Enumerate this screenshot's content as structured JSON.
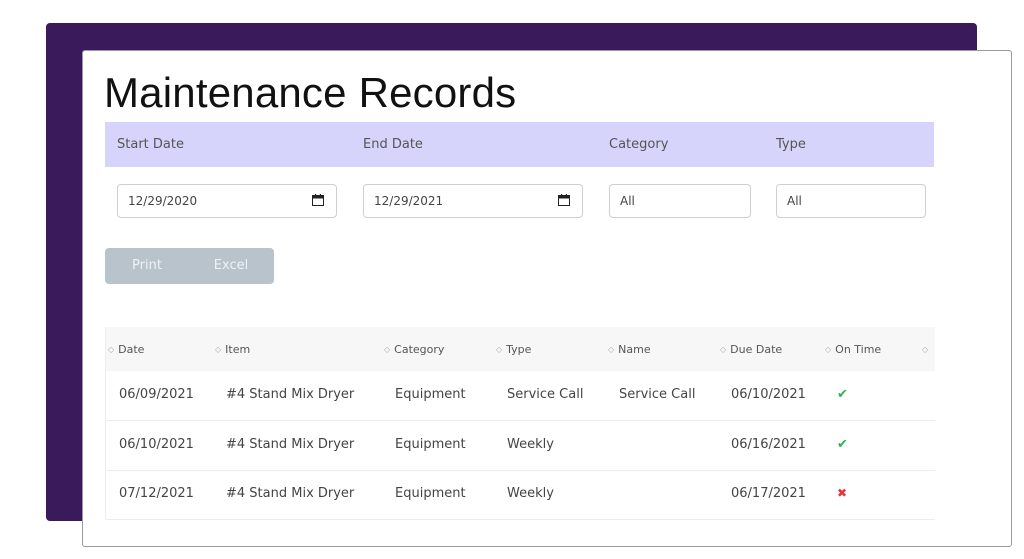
{
  "page": {
    "title": "Maintenance Records"
  },
  "filters": {
    "start_label": "Start Date",
    "end_label": "End Date",
    "category_label": "Category",
    "type_label": "Type",
    "start_value": "12/29/2020",
    "end_value": "12/29/2021",
    "category_value": "All",
    "type_value": "All"
  },
  "actions": {
    "print_label": "Print",
    "excel_label": "Excel"
  },
  "table": {
    "headers": [
      "Date",
      "Item",
      "Category",
      "Type",
      "Name",
      "Due Date",
      "On Time"
    ],
    "rows": [
      {
        "date": "06/09/2021",
        "item": "#4 Stand Mix Dryer",
        "category": "Equipment",
        "type": "Service Call",
        "name": "Service Call",
        "due": "06/10/2021",
        "on_time": "✔"
      },
      {
        "date": "06/10/2021",
        "item": "#4 Stand Mix Dryer",
        "category": "Equipment",
        "type": "Weekly",
        "name": "",
        "due": "06/16/2021",
        "on_time": "✔"
      },
      {
        "date": "07/12/2021",
        "item": "#4 Stand Mix Dryer",
        "category": "Equipment",
        "type": "Weekly",
        "name": "",
        "due": "06/17/2021",
        "on_time": "✖"
      }
    ]
  },
  "colors": {
    "backdrop": "#3a1a5a",
    "filter_header": "#d6d4fa",
    "check": "#2fb350",
    "cross": "#e3363b",
    "button_bg": "#b8c3cc"
  }
}
